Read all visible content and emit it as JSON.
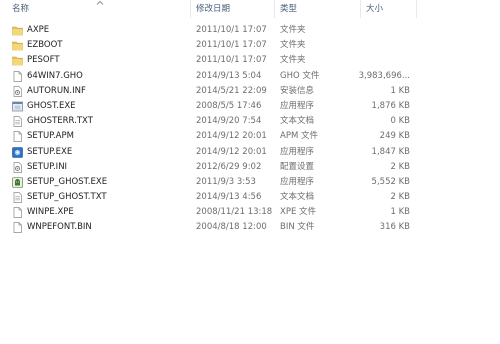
{
  "columns": {
    "name": "名称",
    "date": "修改日期",
    "type": "类型",
    "size": "大小"
  },
  "files": [
    {
      "name": "AXPE",
      "date": "2011/10/1 17:07",
      "type": "文件夹",
      "size": "",
      "icon": "folder-icon"
    },
    {
      "name": "EZBOOT",
      "date": "2011/10/1 17:07",
      "type": "文件夹",
      "size": "",
      "icon": "folder-icon"
    },
    {
      "name": "PESOFT",
      "date": "2011/10/1 17:07",
      "type": "文件夹",
      "size": "",
      "icon": "folder-icon"
    },
    {
      "name": "64WIN7.GHO",
      "date": "2014/9/13 5:04",
      "type": "GHO 文件",
      "size": "3,983,696...",
      "icon": "file-icon"
    },
    {
      "name": "AUTORUN.INF",
      "date": "2014/5/21 22:09",
      "type": "安装信息",
      "size": "1 KB",
      "icon": "settings-file-icon"
    },
    {
      "name": "GHOST.EXE",
      "date": "2008/5/5 17:46",
      "type": "应用程序",
      "size": "1,876 KB",
      "icon": "app-window-icon"
    },
    {
      "name": "GHOSTERR.TXT",
      "date": "2014/9/20 7:54",
      "type": "文本文档",
      "size": "0 KB",
      "icon": "text-file-icon"
    },
    {
      "name": "SETUP.APM",
      "date": "2014/9/12 20:01",
      "type": "APM 文件",
      "size": "249 KB",
      "icon": "file-icon"
    },
    {
      "name": "SETUP.EXE",
      "date": "2014/9/12 20:01",
      "type": "应用程序",
      "size": "1,847 KB",
      "icon": "setup-app-icon"
    },
    {
      "name": "SETUP.INI",
      "date": "2012/6/29 9:02",
      "type": "配置设置",
      "size": "2 KB",
      "icon": "settings-file-icon"
    },
    {
      "name": "SETUP_GHOST.EXE",
      "date": "2011/9/3 3:53",
      "type": "应用程序",
      "size": "5,552 KB",
      "icon": "ghost-app-icon"
    },
    {
      "name": "SETUP_GHOST.TXT",
      "date": "2014/9/13 4:56",
      "type": "文本文档",
      "size": "2 KB",
      "icon": "text-file-icon"
    },
    {
      "name": "WINPE.XPE",
      "date": "2008/11/21 13:18",
      "type": "XPE 文件",
      "size": "1 KB",
      "icon": "file-icon"
    },
    {
      "name": "WNPEFONT.BIN",
      "date": "2004/8/18 12:00",
      "type": "BIN 文件",
      "size": "316 KB",
      "icon": "file-icon"
    }
  ]
}
